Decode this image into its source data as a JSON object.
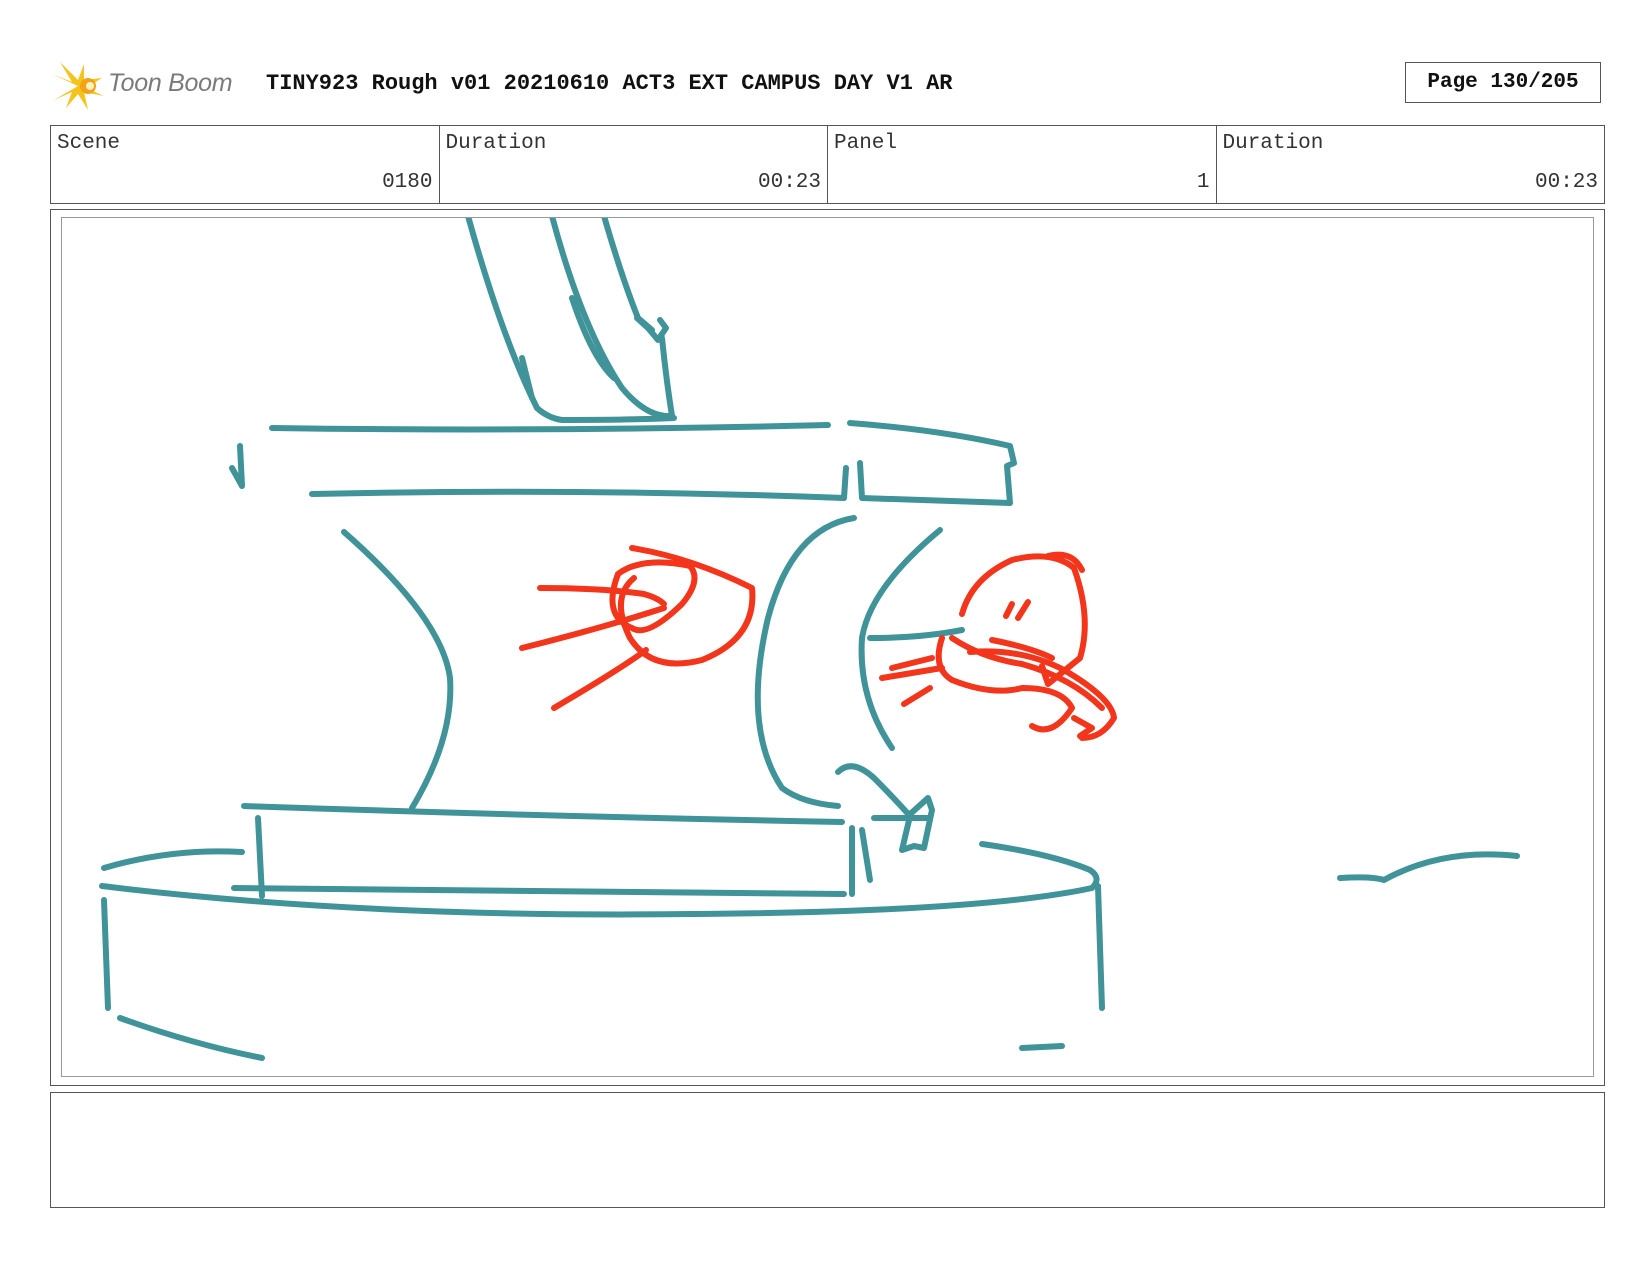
{
  "header": {
    "logo_text": "Toon Boom",
    "title": "TINY923 Rough v01 20210610 ACT3 EXT CAMPUS DAY V1 AR",
    "page": "Page 130/205"
  },
  "info": [
    {
      "label": "Scene",
      "value": "0180"
    },
    {
      "label": "Duration",
      "value": "00:23"
    },
    {
      "label": "Panel",
      "value": "1"
    },
    {
      "label": "Duration",
      "value": "00:23"
    }
  ],
  "sketch": {
    "description_icons": [
      "anvil-sketch",
      "hand-sketch",
      "impact-marks-sketch"
    ],
    "colors": {
      "line": "#3f9399",
      "accent": "#f2351b"
    }
  },
  "notes": {
    "text": ""
  }
}
